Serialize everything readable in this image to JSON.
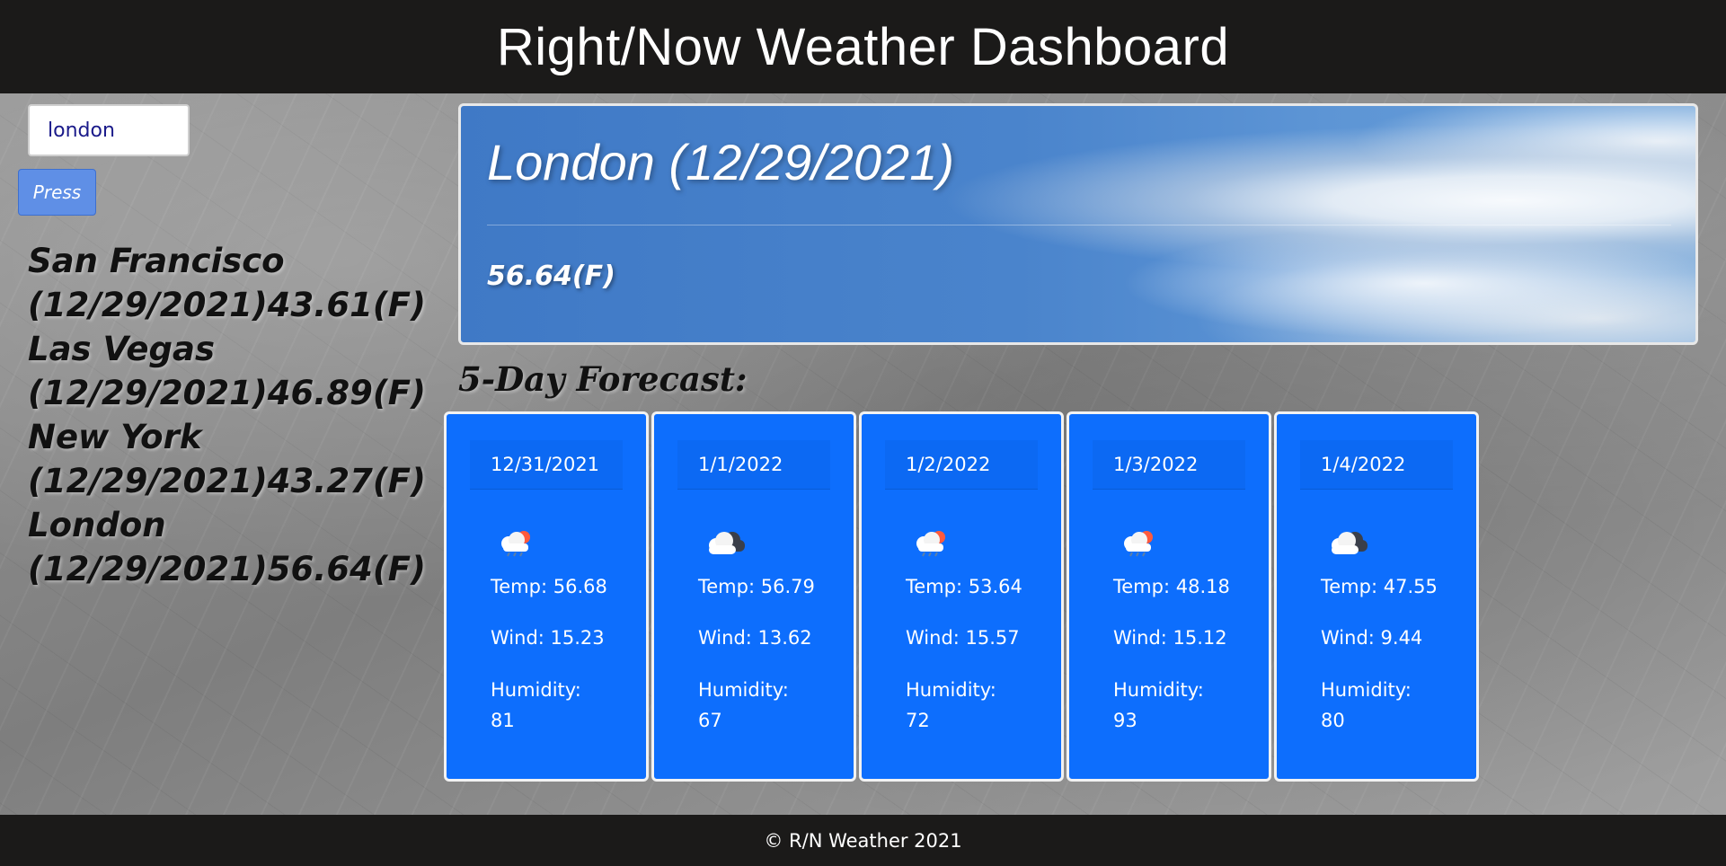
{
  "header": {
    "title": "Right/Now Weather Dashboard"
  },
  "search": {
    "value": "london",
    "button_label": "Press"
  },
  "history": [
    {
      "line1": "San Francisco",
      "line2": "(12/29/2021)43.61(F)"
    },
    {
      "line1": "Las Vegas",
      "line2": "(12/29/2021)46.89(F)"
    },
    {
      "line1": "New York",
      "line2": "(12/29/2021)43.27(F)"
    },
    {
      "line1": "London",
      "line2": "(12/29/2021)56.64(F)"
    }
  ],
  "current": {
    "title": "London (12/29/2021)",
    "temp": "56.64(F)"
  },
  "forecast_heading": "5-Day Forecast:",
  "forecast": [
    {
      "date": "12/31/2021",
      "icon": "cloud-sun-rain-icon",
      "temp": "Temp: 56.68",
      "wind": "Wind: 15.23",
      "humidity_label": "Humidity:",
      "humidity": "81"
    },
    {
      "date": "1/1/2022",
      "icon": "clouds-icon",
      "temp": "Temp: 56.79",
      "wind": "Wind: 13.62",
      "humidity_label": "Humidity:",
      "humidity": "67"
    },
    {
      "date": "1/2/2022",
      "icon": "cloud-sun-rain-icon",
      "temp": "Temp: 53.64",
      "wind": "Wind: 15.57",
      "humidity_label": "Humidity:",
      "humidity": "72"
    },
    {
      "date": "1/3/2022",
      "icon": "cloud-sun-rain-icon",
      "temp": "Temp: 48.18",
      "wind": "Wind: 15.12",
      "humidity_label": "Humidity:",
      "humidity": "93"
    },
    {
      "date": "1/4/2022",
      "icon": "clouds-icon",
      "temp": "Temp: 47.55",
      "wind": "Wind: 9.44",
      "humidity_label": "Humidity:",
      "humidity": "80"
    }
  ],
  "footer": {
    "text": "© R/N Weather 2021"
  },
  "colors": {
    "header_bg": "#1b1a19",
    "card_blue": "#0d6efd",
    "button_blue": "#5f8fe6"
  }
}
